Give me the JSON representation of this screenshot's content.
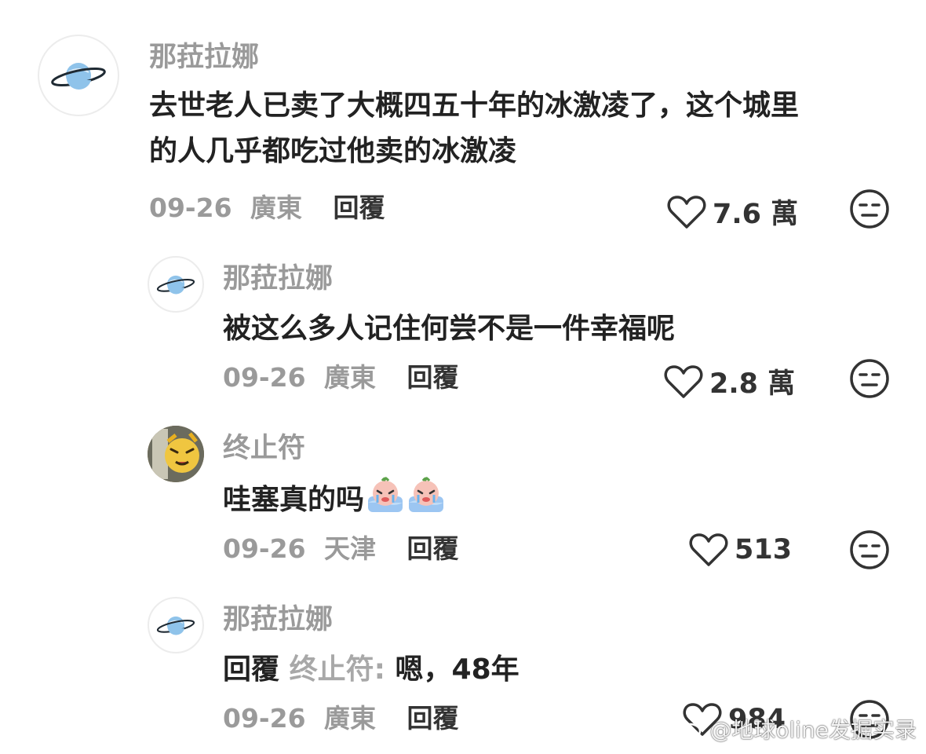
{
  "comments": [
    {
      "username": "那菈拉娜",
      "content_lines": [
        "去世老人已卖了大概四五十年的冰激凌了，这个城里",
        "的人几乎都吃过他卖的冰激凌"
      ],
      "date": "09-26",
      "location": "廣東",
      "reply_label": "回覆",
      "likes": "7.6 萬",
      "avatar_icon": "planet-icon"
    },
    {
      "username": "那菈拉娜",
      "content": "被这么多人记住何尝不是一件幸福呢",
      "date": "09-26",
      "location": "廣東",
      "reply_label": "回覆",
      "likes": "2.8 萬",
      "avatar_icon": "planet-icon"
    },
    {
      "username": "终止符",
      "content": "哇塞真的吗",
      "emojis": [
        "crying-emoji",
        "crying-emoji"
      ],
      "date": "09-26",
      "location": "天津",
      "reply_label": "回覆",
      "likes": "513",
      "avatar_icon": "photo-avatar"
    },
    {
      "username": "那菈拉娜",
      "reply_prefix": "回覆",
      "reply_to": "终止符:",
      "content": "嗯，48年",
      "date": "09-26",
      "location": "廣東",
      "reply_label": "回覆",
      "likes": "984",
      "avatar_icon": "planet-icon"
    }
  ],
  "watermark": "@地球oline发掘实录",
  "colors": {
    "text": "#222222",
    "meta": "#9a9a9a",
    "planet": "#8fc3ea",
    "planet_ring": "#1f2a33"
  }
}
